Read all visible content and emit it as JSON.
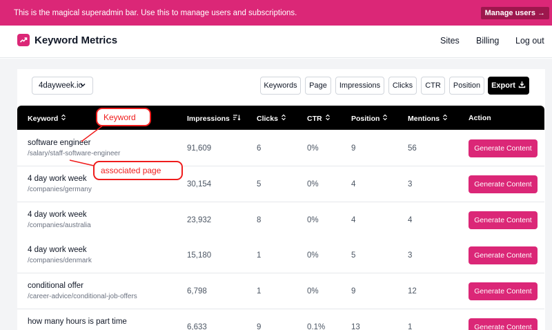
{
  "admin_bar": {
    "message": "This is the magical superadmin bar. Use this to manage users and subscriptions.",
    "manage_users": "Manage users →"
  },
  "brand": {
    "name": "Keyword Metrics",
    "icon": "trending-up-icon"
  },
  "nav": {
    "sites": "Sites",
    "billing": "Billing",
    "logout": "Log out"
  },
  "site_select": {
    "value": "4dayweek.io"
  },
  "toolbar": {
    "keywords": "Keywords",
    "page": "Page",
    "impressions": "Impressions",
    "clicks": "Clicks",
    "ctr": "CTR",
    "position": "Position",
    "export": "Export"
  },
  "table": {
    "headers": {
      "keyword": "Keyword",
      "impressions": "Impressions",
      "clicks": "Clicks",
      "ctr": "CTR",
      "position": "Position",
      "mentions": "Mentions",
      "action": "Action"
    },
    "action_label": "Generate Content",
    "rows": [
      {
        "keyword": "software engineer",
        "page": "/salary/staff-software-engineer",
        "impressions": "91,609",
        "clicks": "6",
        "ctr": "0%",
        "position": "9",
        "mentions": "56"
      },
      {
        "keyword": "4 day work week",
        "page": "/companies/germany",
        "impressions": "30,154",
        "clicks": "5",
        "ctr": "0%",
        "position": "4",
        "mentions": "3"
      },
      {
        "keyword": "4 day work week",
        "page": "/companies/australia",
        "impressions": "23,932",
        "clicks": "8",
        "ctr": "0%",
        "position": "4",
        "mentions": "4"
      },
      {
        "keyword": "4 day work week",
        "page": "/companies/denmark",
        "impressions": "15,180",
        "clicks": "1",
        "ctr": "0%",
        "position": "5",
        "mentions": "3"
      },
      {
        "keyword": "conditional offer",
        "page": "/career-advice/conditional-job-offers",
        "impressions": "6,798",
        "clicks": "1",
        "ctr": "0%",
        "position": "9",
        "mentions": "12"
      },
      {
        "keyword": "how many hours is part time",
        "page": "",
        "impressions": "6,633",
        "clicks": "9",
        "ctr": "0.1%",
        "position": "13",
        "mentions": "1"
      }
    ]
  },
  "annotations": {
    "keyword": "Keyword",
    "page": "associated page"
  },
  "colors": {
    "accent": "#db2777",
    "admin_bar": "#db2777",
    "header": "#000000",
    "annotation": "#ef1c1c"
  }
}
